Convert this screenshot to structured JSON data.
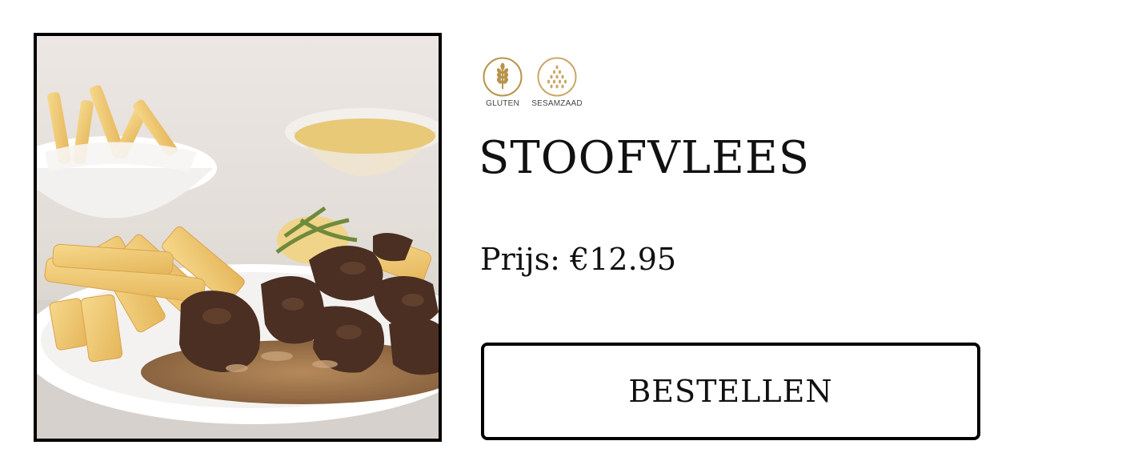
{
  "product": {
    "title": "STOOFVLEES",
    "price_label": "Prijs:",
    "price_value": "€12.95",
    "image_description_icon": "stoofvlees-dish-photo",
    "order_button_label": "BESTELLEN"
  },
  "allergens": [
    {
      "label": "GLUTEN",
      "icon": "wheat-icon"
    },
    {
      "label": "SESAMZAAD",
      "icon": "sesame-seeds-icon"
    }
  ],
  "colors": {
    "allergen_gold": "#b8924a",
    "allergen_gold_light": "#c9a76a",
    "border": "#000000",
    "text": "#111111"
  }
}
